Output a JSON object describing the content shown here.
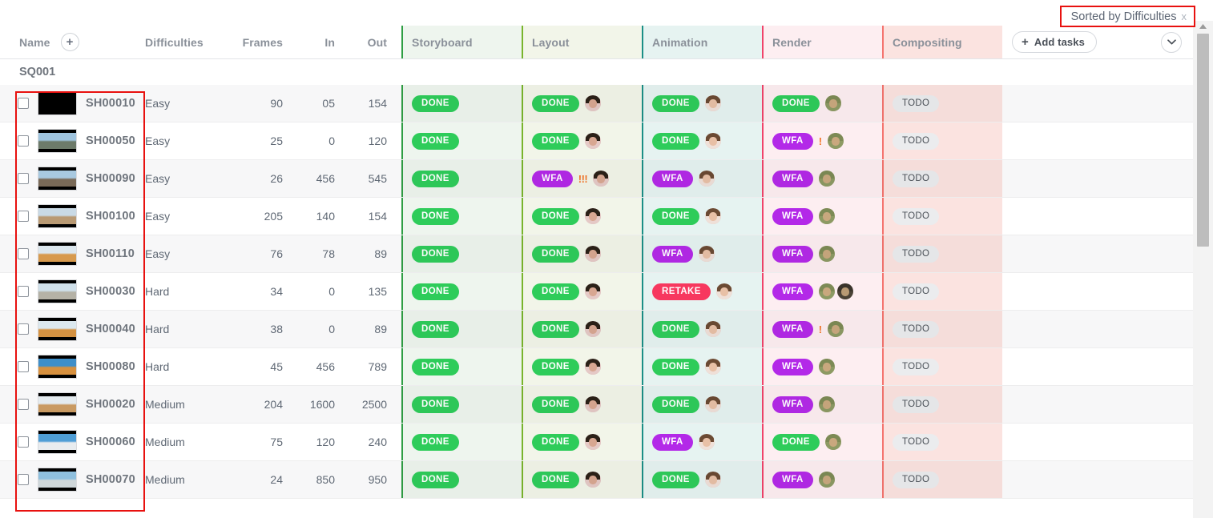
{
  "sort_badge": {
    "label": "Sorted by Difficulties",
    "close": "x",
    "border_color": "#e8110f"
  },
  "toolbar": {
    "add_tasks_label": "Add tasks",
    "plus_icon": "plus-icon",
    "chevron_icon": "chevron-down-icon"
  },
  "columns": {
    "name": "Name",
    "difficulties": "Difficulties",
    "frames": "Frames",
    "in": "In",
    "out": "Out"
  },
  "task_columns": [
    {
      "label": "Storyboard",
      "border": "#2f9e44",
      "bg": "#eef5ee"
    },
    {
      "label": "Layout",
      "border": "#79b42c",
      "bg": "#f2f5e9"
    },
    {
      "label": "Animation",
      "border": "#1b8f86",
      "bg": "#e6f3f1"
    },
    {
      "label": "Render",
      "border": "#f0436a",
      "bg": "#fdeef1"
    },
    {
      "label": "Compositing",
      "border": "#f4746e",
      "bg": "#fbe3e0"
    }
  ],
  "group": {
    "label": "SQ001"
  },
  "rows": [
    {
      "name": "SH00010",
      "difficulty": "Easy",
      "frames": "90",
      "in": "05",
      "out": "154",
      "thumb": [
        "#000000",
        "#000000"
      ],
      "tasks": [
        {
          "status": "DONE"
        },
        {
          "status": "DONE",
          "avatars": [
            "f1"
          ]
        },
        {
          "status": "DONE",
          "avatars": [
            "f2"
          ]
        },
        {
          "status": "DONE",
          "avatars": [
            "m1"
          ]
        },
        {
          "status": "TODO"
        }
      ]
    },
    {
      "name": "SH00050",
      "difficulty": "Easy",
      "frames": "25",
      "in": "0",
      "out": "120",
      "thumb": [
        "#9fc4de",
        "#6d7b6a"
      ],
      "tasks": [
        {
          "status": "DONE"
        },
        {
          "status": "DONE",
          "avatars": [
            "f1"
          ]
        },
        {
          "status": "DONE",
          "avatars": [
            "f2"
          ]
        },
        {
          "status": "WFA",
          "priority": "!",
          "avatars": [
            "m1"
          ]
        },
        {
          "status": "TODO"
        }
      ]
    },
    {
      "name": "SH00090",
      "difficulty": "Easy",
      "frames": "26",
      "in": "456",
      "out": "545",
      "thumb": [
        "#a8c9e0",
        "#7a6a58"
      ],
      "tasks": [
        {
          "status": "DONE"
        },
        {
          "status": "WFA",
          "priority": "!!!",
          "avatars": [
            "f1"
          ]
        },
        {
          "status": "WFA",
          "avatars": [
            "f2"
          ]
        },
        {
          "status": "WFA",
          "avatars": [
            "m1"
          ]
        },
        {
          "status": "TODO"
        }
      ]
    },
    {
      "name": "SH00100",
      "difficulty": "Easy",
      "frames": "205",
      "in": "140",
      "out": "154",
      "thumb": [
        "#c9dae6",
        "#b99a74"
      ],
      "tasks": [
        {
          "status": "DONE"
        },
        {
          "status": "DONE",
          "avatars": [
            "f1"
          ]
        },
        {
          "status": "DONE",
          "avatars": [
            "f2"
          ]
        },
        {
          "status": "WFA",
          "avatars": [
            "m1"
          ]
        },
        {
          "status": "TODO"
        }
      ]
    },
    {
      "name": "SH00110",
      "difficulty": "Easy",
      "frames": "76",
      "in": "78",
      "out": "89",
      "thumb": [
        "#dce7ee",
        "#d79a4e"
      ],
      "tasks": [
        {
          "status": "DONE"
        },
        {
          "status": "DONE",
          "avatars": [
            "f1"
          ]
        },
        {
          "status": "WFA",
          "avatars": [
            "f2"
          ]
        },
        {
          "status": "WFA",
          "avatars": [
            "m1"
          ]
        },
        {
          "status": "TODO"
        }
      ]
    },
    {
      "name": "SH00030",
      "difficulty": "Hard",
      "frames": "34",
      "in": "0",
      "out": "135",
      "thumb": [
        "#cfe0ea",
        "#b5b2a6"
      ],
      "tasks": [
        {
          "status": "DONE"
        },
        {
          "status": "DONE",
          "avatars": [
            "f1"
          ]
        },
        {
          "status": "RETAKE",
          "avatars": [
            "f2"
          ]
        },
        {
          "status": "WFA",
          "avatars": [
            "m1",
            "m2"
          ]
        },
        {
          "status": "TODO"
        }
      ]
    },
    {
      "name": "SH00040",
      "difficulty": "Hard",
      "frames": "38",
      "in": "0",
      "out": "89",
      "thumb": [
        "#dbe8ef",
        "#d59242"
      ],
      "tasks": [
        {
          "status": "DONE"
        },
        {
          "status": "DONE",
          "avatars": [
            "f1"
          ]
        },
        {
          "status": "DONE",
          "avatars": [
            "f2"
          ]
        },
        {
          "status": "WFA",
          "priority": "!",
          "avatars": [
            "m1"
          ]
        },
        {
          "status": "TODO"
        }
      ]
    },
    {
      "name": "SH00080",
      "difficulty": "Hard",
      "frames": "45",
      "in": "456",
      "out": "789",
      "thumb": [
        "#3f8fc9",
        "#d8913f"
      ],
      "tasks": [
        {
          "status": "DONE"
        },
        {
          "status": "DONE",
          "avatars": [
            "f1"
          ]
        },
        {
          "status": "DONE",
          "avatars": [
            "f2"
          ]
        },
        {
          "status": "WFA",
          "avatars": [
            "m1"
          ]
        },
        {
          "status": "TODO"
        }
      ]
    },
    {
      "name": "SH00020",
      "difficulty": "Medium",
      "frames": "204",
      "in": "1600",
      "out": "2500",
      "thumb": [
        "#e4ebef",
        "#c99a62"
      ],
      "tasks": [
        {
          "status": "DONE"
        },
        {
          "status": "DONE",
          "avatars": [
            "f1"
          ]
        },
        {
          "status": "DONE",
          "avatars": [
            "f2"
          ]
        },
        {
          "status": "WFA",
          "avatars": [
            "m1"
          ]
        },
        {
          "status": "TODO"
        }
      ]
    },
    {
      "name": "SH00060",
      "difficulty": "Medium",
      "frames": "75",
      "in": "120",
      "out": "240",
      "thumb": [
        "#4f9ed6",
        "#e8ecef"
      ],
      "tasks": [
        {
          "status": "DONE"
        },
        {
          "status": "DONE",
          "avatars": [
            "f1"
          ]
        },
        {
          "status": "WFA",
          "avatars": [
            "f2"
          ]
        },
        {
          "status": "DONE",
          "avatars": [
            "m1"
          ]
        },
        {
          "status": "TODO"
        }
      ]
    },
    {
      "name": "SH00070",
      "difficulty": "Medium",
      "frames": "24",
      "in": "850",
      "out": "950",
      "thumb": [
        "#8fc0de",
        "#cfd7da"
      ],
      "tasks": [
        {
          "status": "DONE"
        },
        {
          "status": "DONE",
          "avatars": [
            "f1"
          ]
        },
        {
          "status": "DONE",
          "avatars": [
            "f2"
          ]
        },
        {
          "status": "WFA",
          "avatars": [
            "m1"
          ]
        },
        {
          "status": "TODO"
        }
      ]
    }
  ],
  "avatar_palette": {
    "f1": {
      "bg": "#e5c9c6",
      "hair": "#2b2118",
      "face": "#d8a792"
    },
    "f2": {
      "bg": "#efe0d8",
      "hair": "#6b4a33",
      "face": "#e8c0a6"
    },
    "m1": {
      "bg": "#8d9a63",
      "hair": "#7d8a55",
      "face": "#c9a87e"
    },
    "m2": {
      "bg": "#4a4236",
      "hair": "#3a342b",
      "face": "#b89a74"
    }
  },
  "name_highlight": {
    "border_color": "#e8110f"
  }
}
